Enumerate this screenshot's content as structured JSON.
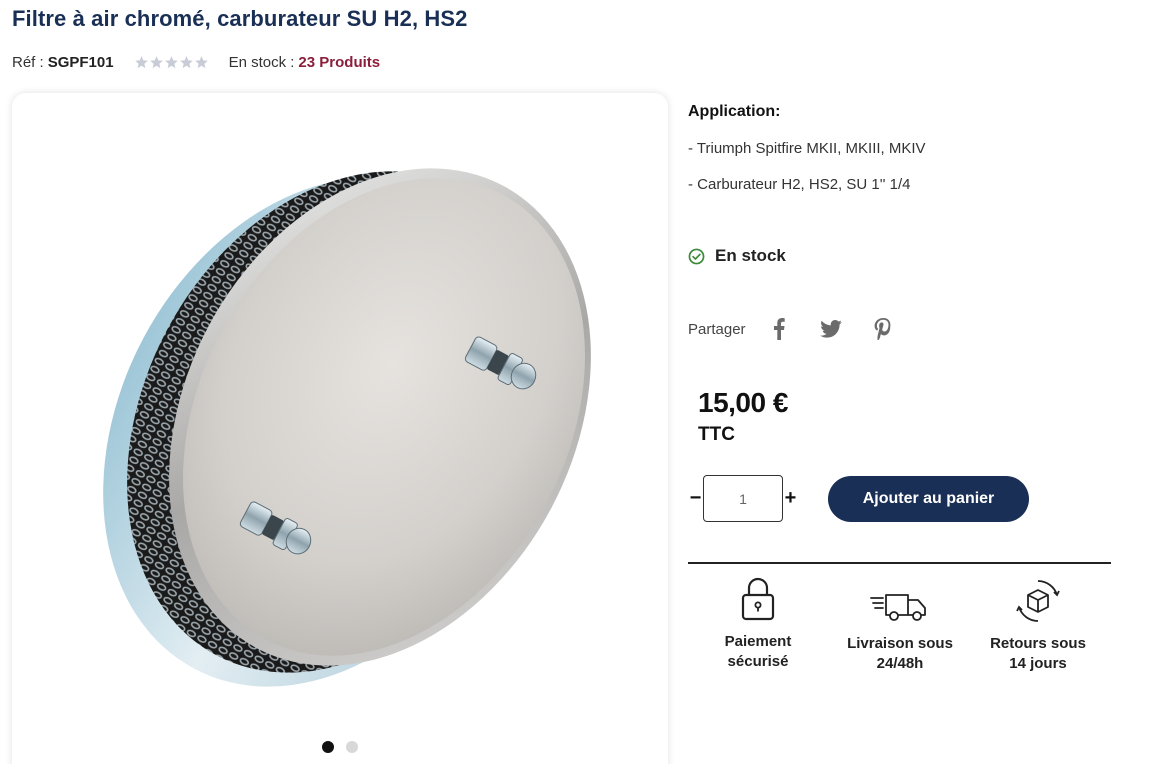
{
  "product": {
    "title": "Filtre à air chromé, carburateur SU H2, HS2",
    "ref_label": "Réf :",
    "ref_value": "SGPF101",
    "rating_stars": 5,
    "rating_value": 0,
    "stock_label": "En stock :",
    "stock_count": "23 Produits"
  },
  "gallery": {
    "image_alt": "Filtre à air chromé",
    "dots": 2,
    "active_dot": 0
  },
  "details": {
    "application_label": "Application:",
    "application_lines": [
      "- Triumph Spitfire MKII, MKIII, MKIV",
      "- Carburateur H2, HS2, SU 1'' 1/4"
    ],
    "availability": "En stock"
  },
  "share": {
    "label": "Partager",
    "networks": [
      "facebook-icon",
      "twitter-icon",
      "pinterest-icon"
    ]
  },
  "pricing": {
    "price": "15,00 €",
    "tax_label": "TTC"
  },
  "cart": {
    "minus": "−",
    "plus": "+",
    "quantity": "1",
    "add_label": "Ajouter au panier"
  },
  "features": [
    {
      "icon": "lock-icon",
      "line1": "Paiement",
      "line2": "sécurisé"
    },
    {
      "icon": "delivery-truck-icon",
      "line1": "Livraison sous",
      "line2": "24/48h"
    },
    {
      "icon": "return-box-icon",
      "line1": "Retours sous",
      "line2": "14 jours"
    }
  ],
  "colors": {
    "brand_navy": "#1a2f55",
    "stock_count": "#8a1f3c",
    "in_stock_green": "#3c8a3a",
    "star_empty": "#c8ccd6"
  }
}
